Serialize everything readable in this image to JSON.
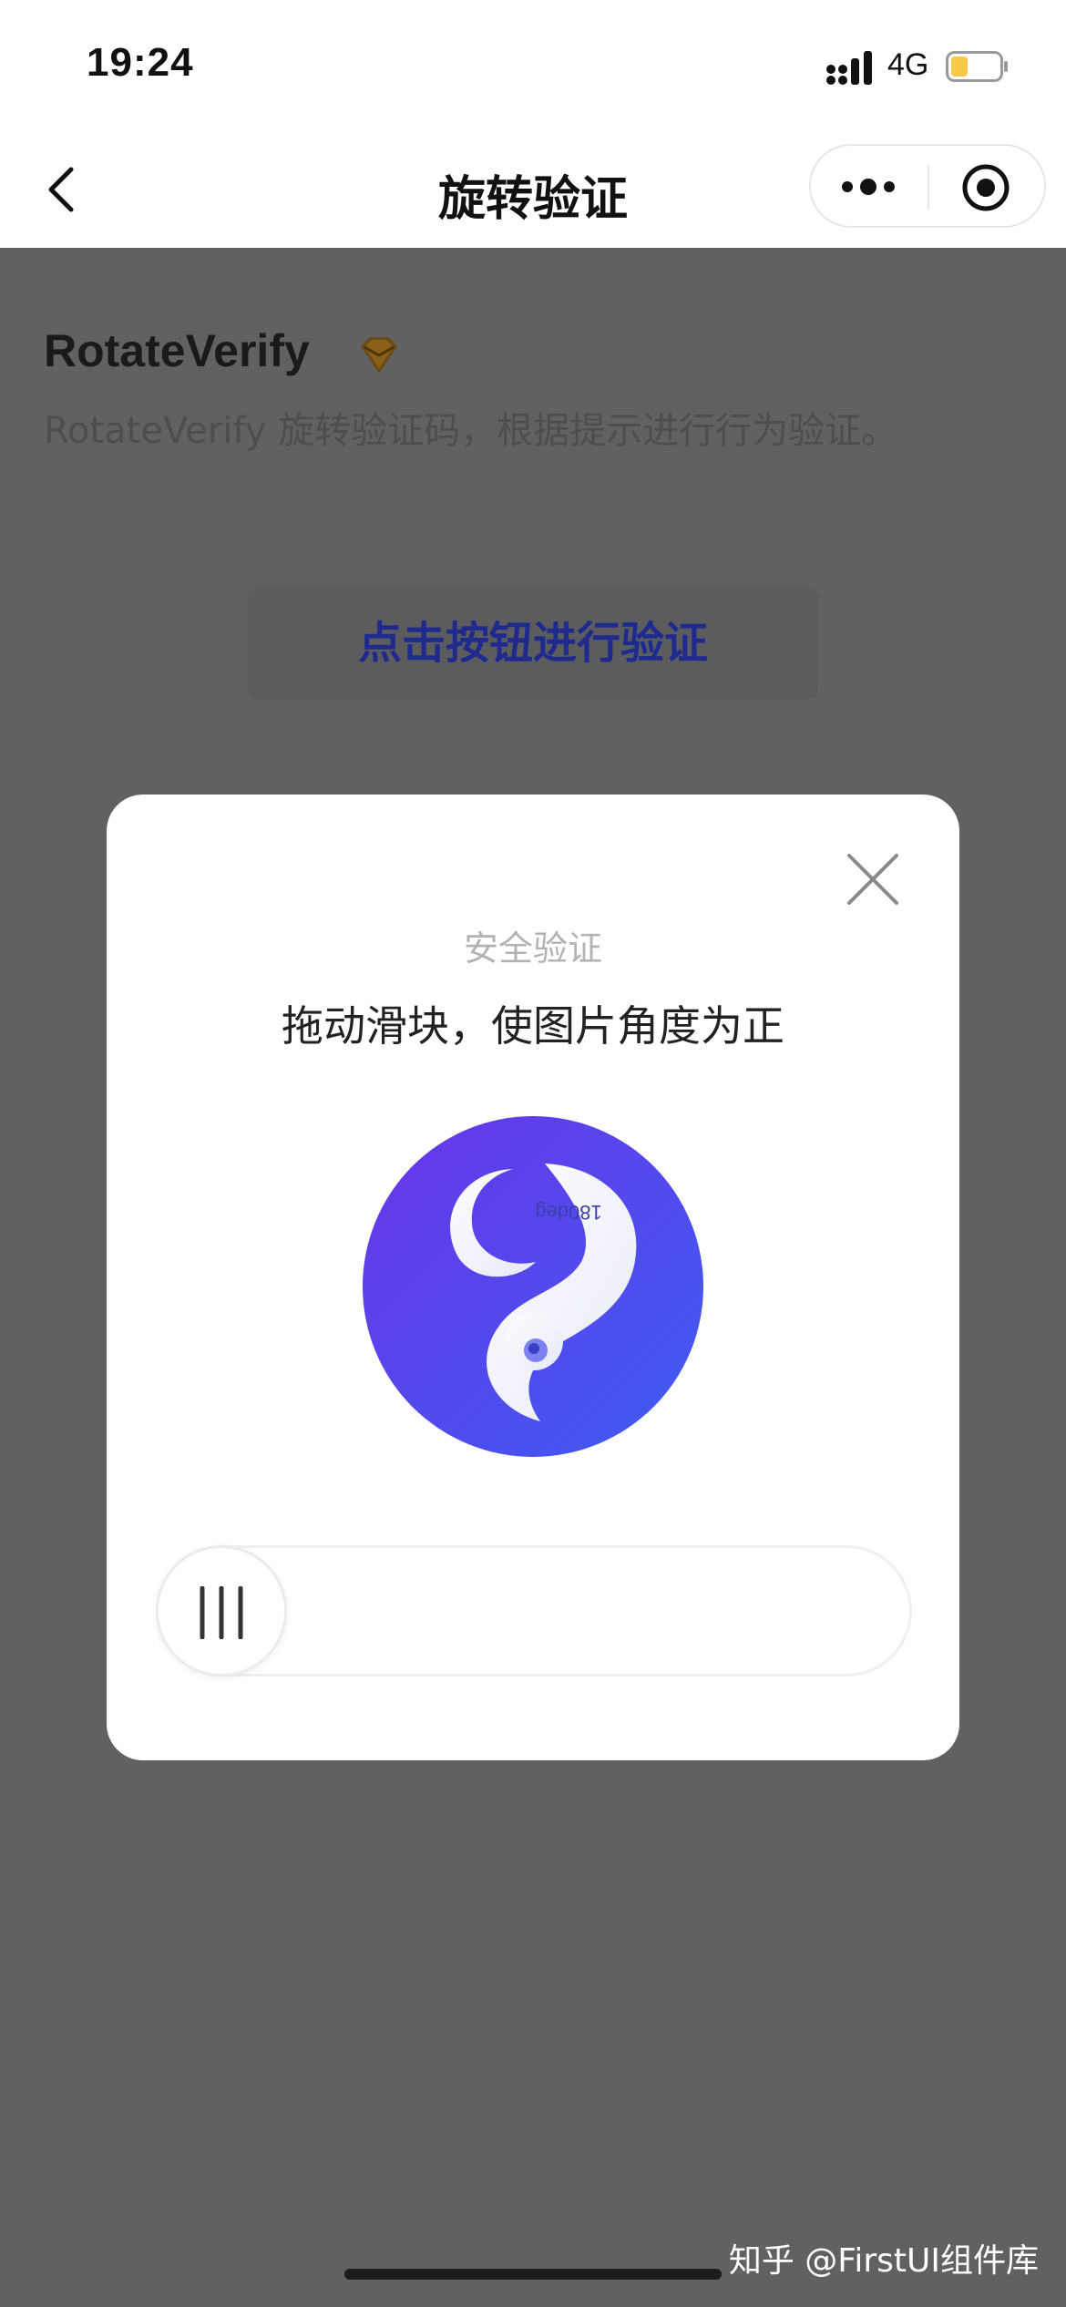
{
  "status_bar": {
    "time": "19:24",
    "network": "4G",
    "battery_level": 0.3,
    "battery_color": "#f7c948"
  },
  "nav": {
    "title": "旋转验证",
    "back_icon": "chevron-left-icon",
    "more_icon": "more-dots-icon",
    "close_icon": "target-circle-icon"
  },
  "page": {
    "title": "RotateVerify",
    "badge_icon": "gem-icon",
    "description": "RotateVerify 旋转验证码，根据提示进行行为验证。",
    "button_label": "点击按钮进行验证"
  },
  "modal": {
    "heading": "安全验证",
    "instruction": "拖动滑块，使图片角度为正",
    "image_text": "180deg",
    "image_rotation_deg": 180,
    "slider_progress": 0,
    "close_icon": "close-x-icon",
    "grip_icon": "grip-lines-icon"
  },
  "colors": {
    "overlay": "#616163",
    "accent": "#1f2a8e",
    "image_gradient_start": "#6a35e8",
    "image_gradient_end": "#3d5cf2"
  },
  "watermark": "知乎 @FirstUI组件库"
}
